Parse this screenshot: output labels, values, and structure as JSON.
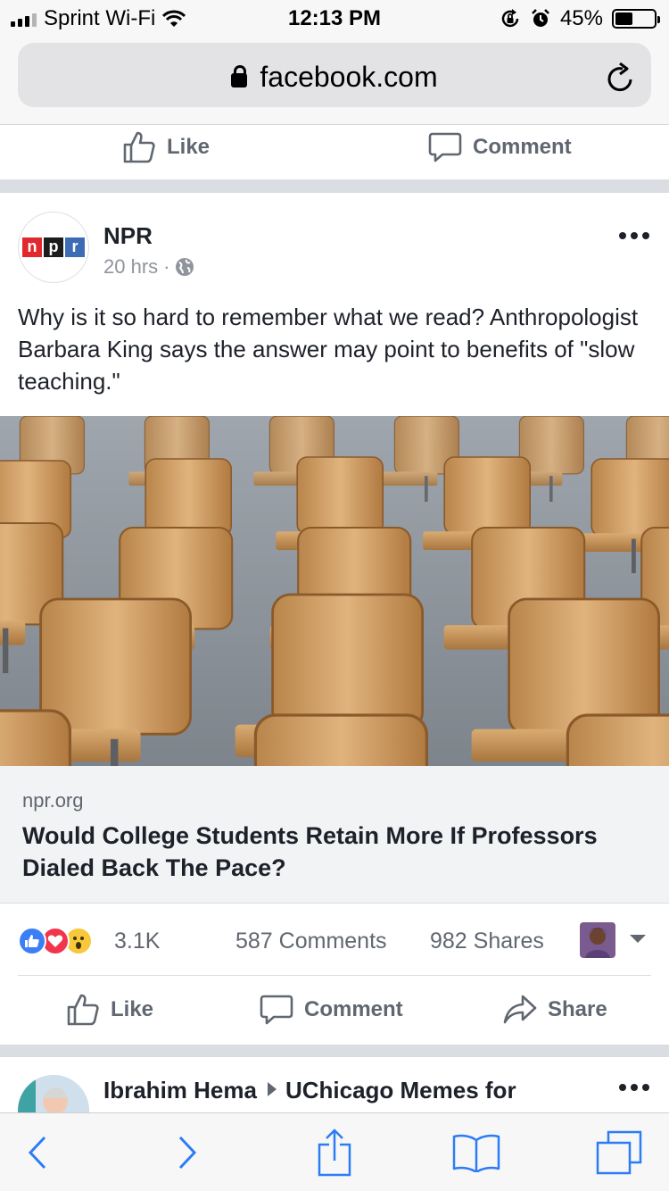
{
  "status_bar": {
    "carrier": "Sprint Wi-Fi",
    "time": "12:13 PM",
    "battery": "45%",
    "battery_level": 0.45
  },
  "browser": {
    "url": "facebook.com"
  },
  "prev_post_actions": {
    "like": "Like",
    "comment": "Comment"
  },
  "post": {
    "page_name": "NPR",
    "time": "20 hrs",
    "separator": "·",
    "logo_letters": [
      "n",
      "p",
      "r"
    ],
    "text": "Why is it so hard to remember what we read? Anthropologist Barbara King says the answer may point to benefits of \"slow teaching.\"",
    "link": {
      "domain": "npr.org",
      "title": "Would College Students Retain More If Professors Dialed Back The Pace?"
    },
    "stats": {
      "reactions": "3.1K",
      "comments": "587 Comments",
      "shares": "982 Shares"
    },
    "actions": {
      "like": "Like",
      "comment": "Comment",
      "share": "Share"
    }
  },
  "next_post": {
    "author": "Ibrahim Hema",
    "group": "UChicago Memes for"
  },
  "colors": {
    "fb_gray": "#606770",
    "like_blue": "#3b7ff6",
    "love_red": "#f0354d",
    "wow_yellow": "#f7c83a",
    "ios_blue": "#2c7cf6"
  },
  "icons": [
    "signal-icon",
    "wifi-icon",
    "rotation-lock-icon",
    "alarm-icon",
    "battery-icon",
    "lock-icon",
    "reload-icon",
    "like-icon",
    "comment-icon",
    "share-icon",
    "globe-icon",
    "more-icon",
    "back-icon",
    "forward-icon",
    "share-sheet-icon",
    "bookmarks-icon",
    "tabs-icon"
  ]
}
